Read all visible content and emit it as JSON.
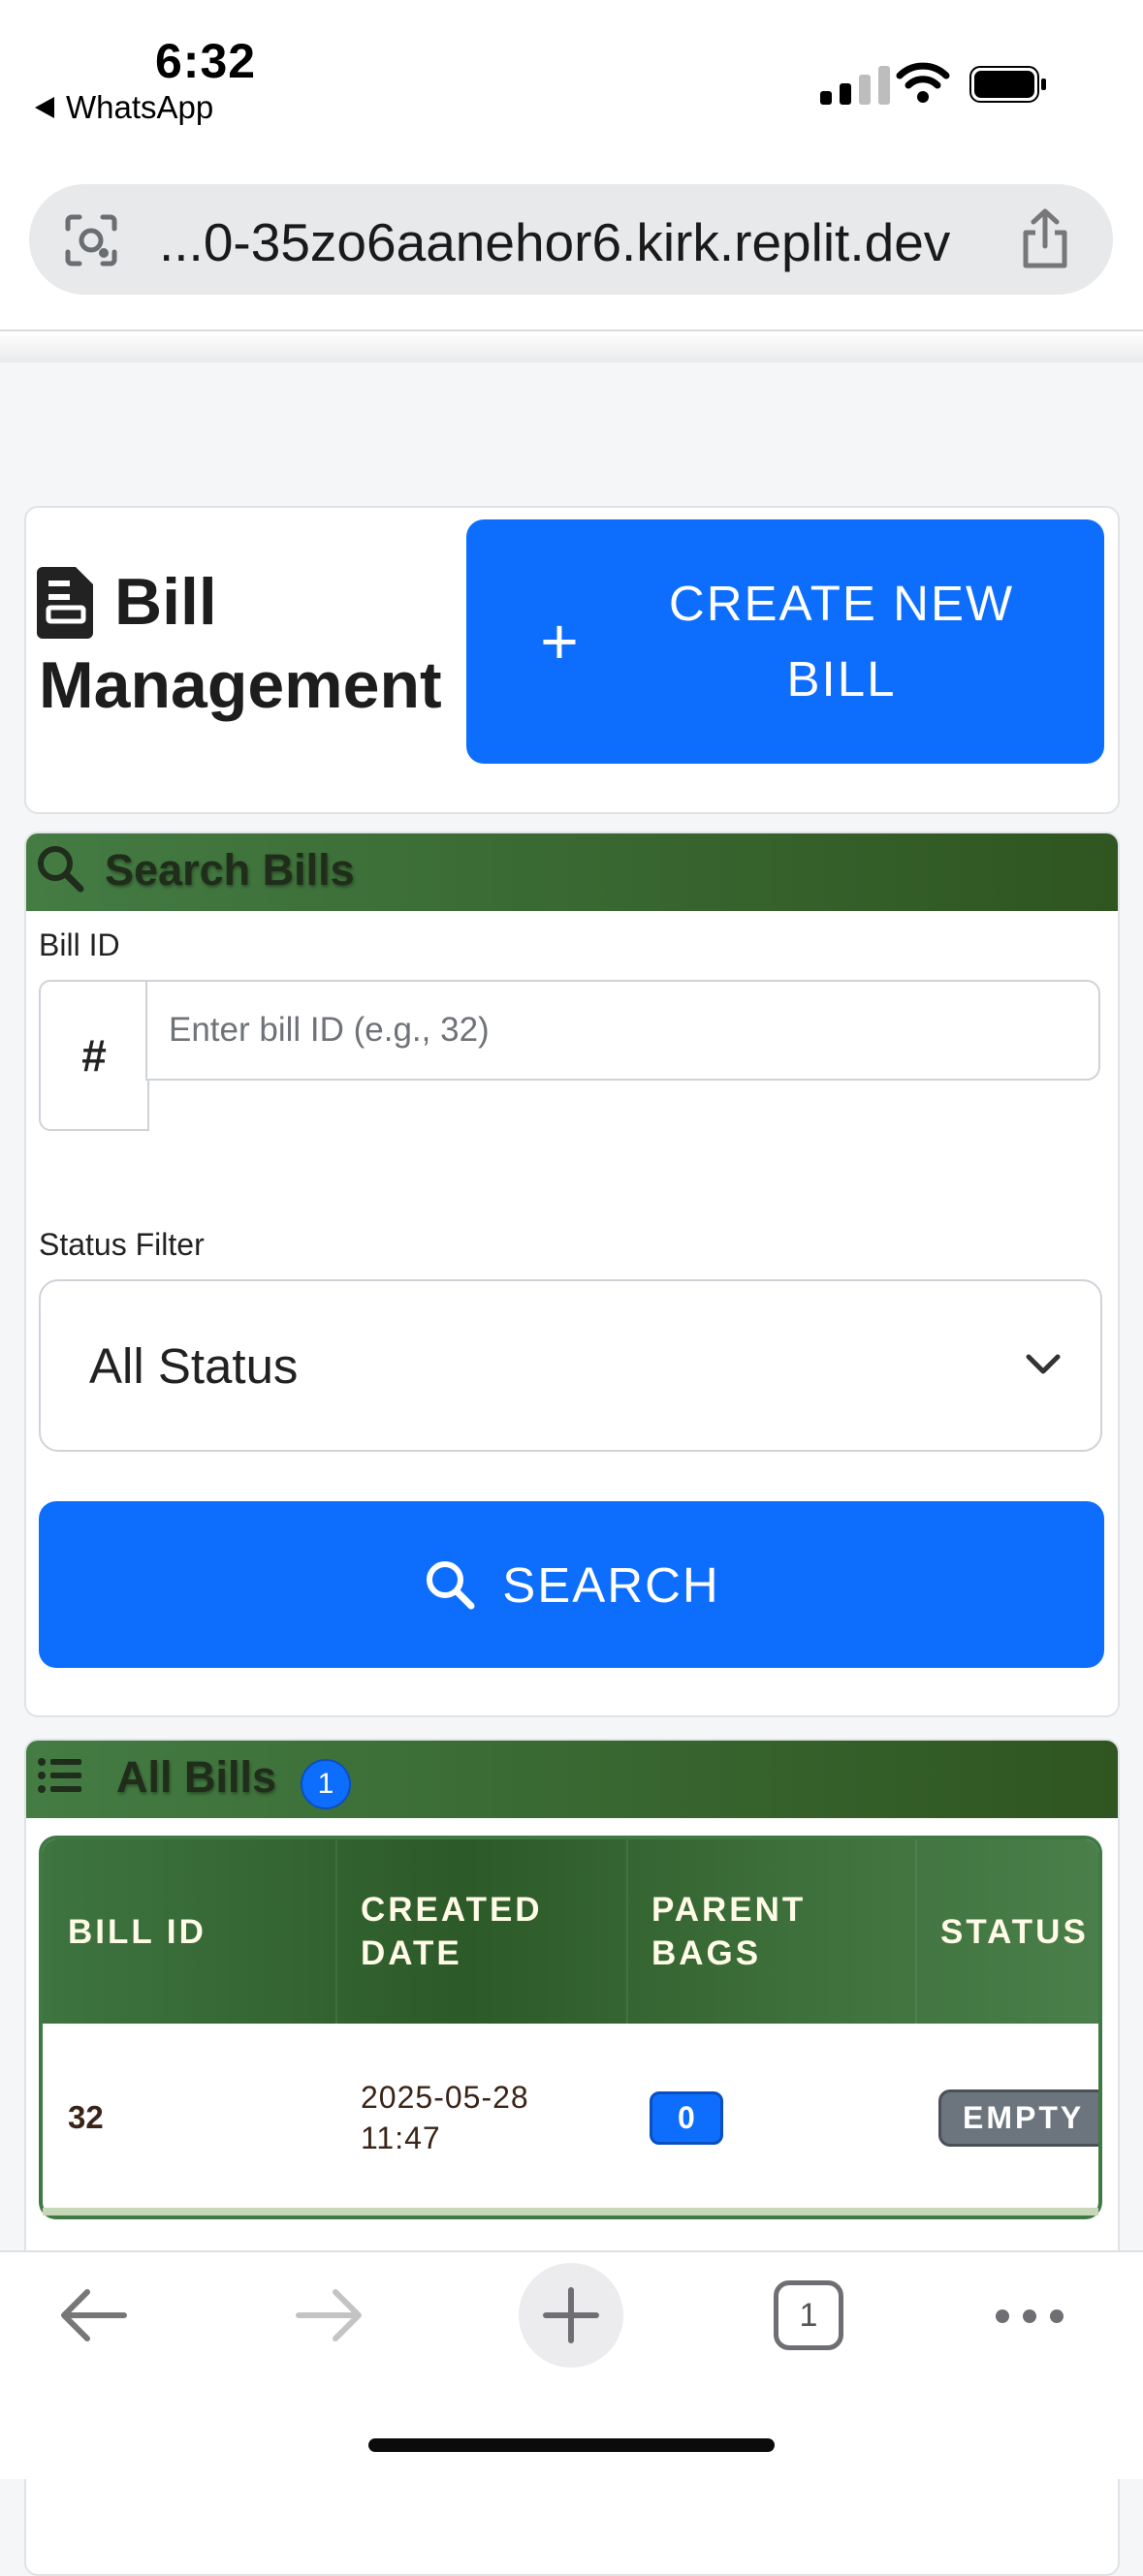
{
  "status_bar": {
    "time": "6:32",
    "back_app": "WhatsApp"
  },
  "browser": {
    "url": "...0-35zo6aanehor6.kirk.replit.dev"
  },
  "header": {
    "title_line1": "Bill",
    "title_line2": "Management",
    "create_button": "CREATE NEW BILL",
    "create_icon": "+"
  },
  "search": {
    "heading": "Search Bills",
    "bill_id_label": "Bill ID",
    "bill_id_prefix": "#",
    "bill_id_placeholder": "Enter bill ID (e.g., 32)",
    "status_label": "Status Filter",
    "status_selected": "All Status",
    "search_button": "SEARCH"
  },
  "bills": {
    "heading": "All Bills",
    "count": "1",
    "columns": [
      "BILL ID",
      "CREATED DATE",
      "PARENT BAGS",
      "STATUS"
    ],
    "rows": [
      {
        "bill_id": "32",
        "created_date_line1": "2025-05-28",
        "created_date_line2": "11:47",
        "parent_bags": "0",
        "status": "EMPTY"
      }
    ]
  },
  "bottom_nav": {
    "tabs_count": "1"
  },
  "colors": {
    "accent": "#0d6efd",
    "header_green": "#2f5520",
    "badge_gray": "#6c757d"
  }
}
